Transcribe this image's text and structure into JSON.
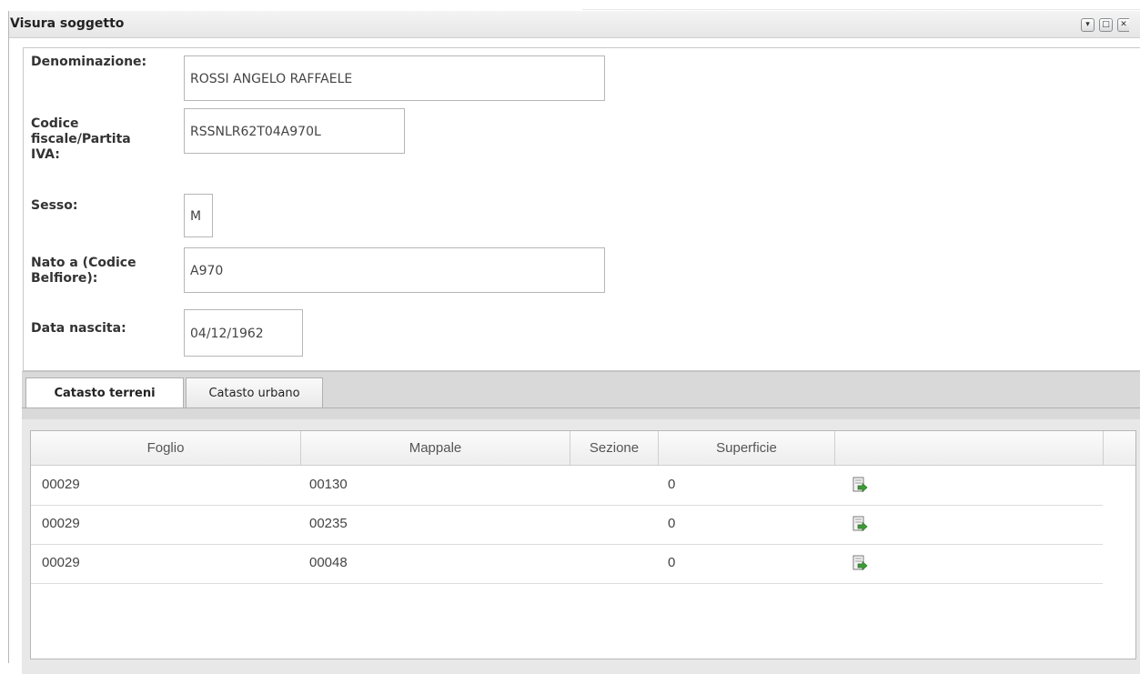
{
  "window": {
    "title": "Visura soggetto",
    "tools": [
      "collapse-icon",
      "maximize-icon",
      "close-icon"
    ]
  },
  "form": {
    "denominazione": {
      "label": "Denominazione:",
      "value": "ROSSI ANGELO RAFFAELE"
    },
    "codice_fiscale": {
      "label": "Codice fiscale/Partita IVA:",
      "value": "RSSNLR62T04A970L"
    },
    "sesso": {
      "label": "Sesso:",
      "value": "M"
    },
    "nato_a": {
      "label": "Nato a (Codice Belfiore):",
      "value": "A970"
    },
    "data_nascita": {
      "label": "Data nascita:",
      "value": "04/12/1962"
    }
  },
  "tabs": [
    {
      "label": "Catasto terreni",
      "active": true
    },
    {
      "label": "Catasto urbano",
      "active": false
    }
  ],
  "grid": {
    "columns": [
      "Foglio",
      "Mappale",
      "Sezione",
      "Superficie",
      ""
    ],
    "rows": [
      {
        "foglio": "00029",
        "mappale": "00130",
        "sezione": "",
        "superficie": "0",
        "action_icon": "open-document-arrow-icon"
      },
      {
        "foglio": "00029",
        "mappale": "00235",
        "sezione": "",
        "superficie": "0",
        "action_icon": "open-document-arrow-icon"
      },
      {
        "foglio": "00029",
        "mappale": "00048",
        "sezione": "",
        "superficie": "0",
        "action_icon": "open-document-arrow-icon"
      }
    ]
  },
  "colors": {
    "accent_green": "#3f9a3a",
    "tabstrip_bg": "#d9d9d9"
  }
}
